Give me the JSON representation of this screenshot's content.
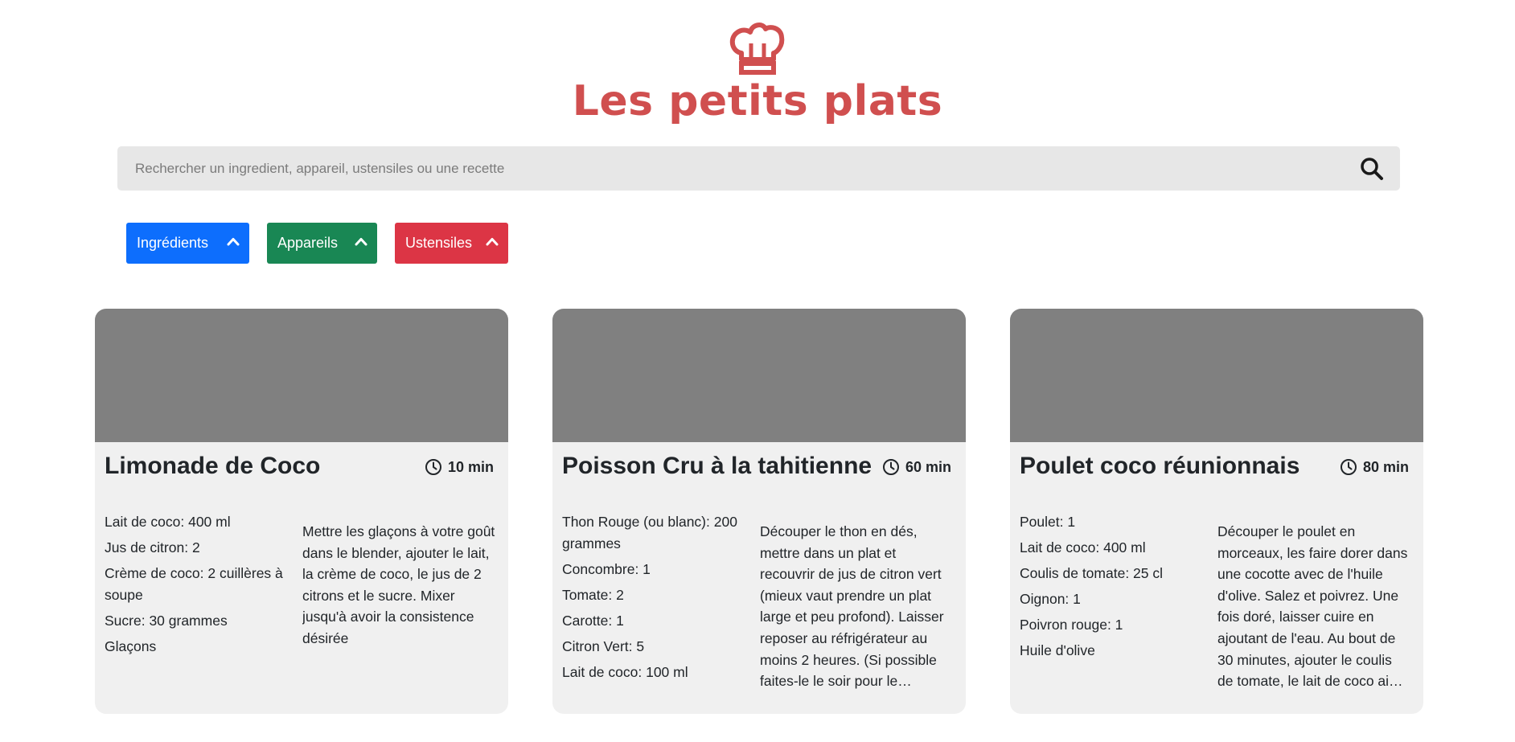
{
  "header": {
    "title": "Les petits plats",
    "logo_icon": "chef-hat-icon",
    "logo_color": "#d04f4f"
  },
  "search": {
    "placeholder": "Rechercher un ingredient, appareil, ustensiles ou une recette",
    "value": "",
    "icon": "search-icon"
  },
  "filters": [
    {
      "label": "Ingrédients",
      "color": "#0d6efd",
      "icon": "chevron-up-icon"
    },
    {
      "label": "Appareils",
      "color": "#198754",
      "icon": "chevron-up-icon"
    },
    {
      "label": "Ustensiles",
      "color": "#dc3545",
      "icon": "chevron-up-icon"
    }
  ],
  "recipes": [
    {
      "title": "Limonade de Coco",
      "time": "10 min",
      "ingredients": [
        "Lait de coco: 400 ml",
        "Jus de citron: 2",
        "Crème de coco: 2 cuillères à soupe",
        "Sucre: 30 grammes",
        "Glaçons"
      ],
      "description": "Mettre les glaçons à votre goût dans le blender, ajouter le lait, la crème de coco, le jus de 2 citrons et le sucre. Mixer jusqu'à avoir la consistence désirée"
    },
    {
      "title": "Poisson Cru à la tahitienne",
      "time": "60 min",
      "ingredients": [
        "Thon Rouge (ou blanc): 200 grammes",
        "Concombre: 1",
        "Tomate: 2",
        "Carotte: 1",
        "Citron Vert: 5",
        "Lait de coco: 100 ml"
      ],
      "description": "Découper le thon en dés, mettre dans un plat et recouvrir de jus de citron vert (mieux vaut prendre un plat large et peu profond). Laisser reposer au réfrigérateur au moins 2 heures. (Si possible faites-le le soir pour le lendemain. Après avoir laissé mariner le poisson, coupez le concombre en fines rondelles sans la peau et les tomates en prenant soin de retirer les pépins. Rayer la carotte. Ajouter les légumes au poissons avec le citron cette fois ci dans un Saladier. Ajouter le lait de coco. Pour ajouter un peu plus de saveur vous pouver ajouter 1 à 2 cuillères à soupe de Crème de coco"
    },
    {
      "title": "Poulet coco réunionnais",
      "time": "80 min",
      "ingredients": [
        "Poulet: 1",
        "Lait de coco: 400 ml",
        "Coulis de tomate: 25 cl",
        "Oignon: 1",
        "Poivron rouge: 1",
        "Huile d'olive"
      ],
      "description": "Découper le poulet en morceaux, les faire dorer dans une cocotte avec de l'huile d'olive. Salez et poivrez. Une fois doré, laisser cuire en ajoutant de l'eau. Au bout de 30 minutes, ajouter le coulis de tomate, le lait de coco ainsi que le poivron et l'oignon découpés en morceaux. Laisser cuisiner 30 minutes de plus. Servir avec du riz"
    }
  ]
}
